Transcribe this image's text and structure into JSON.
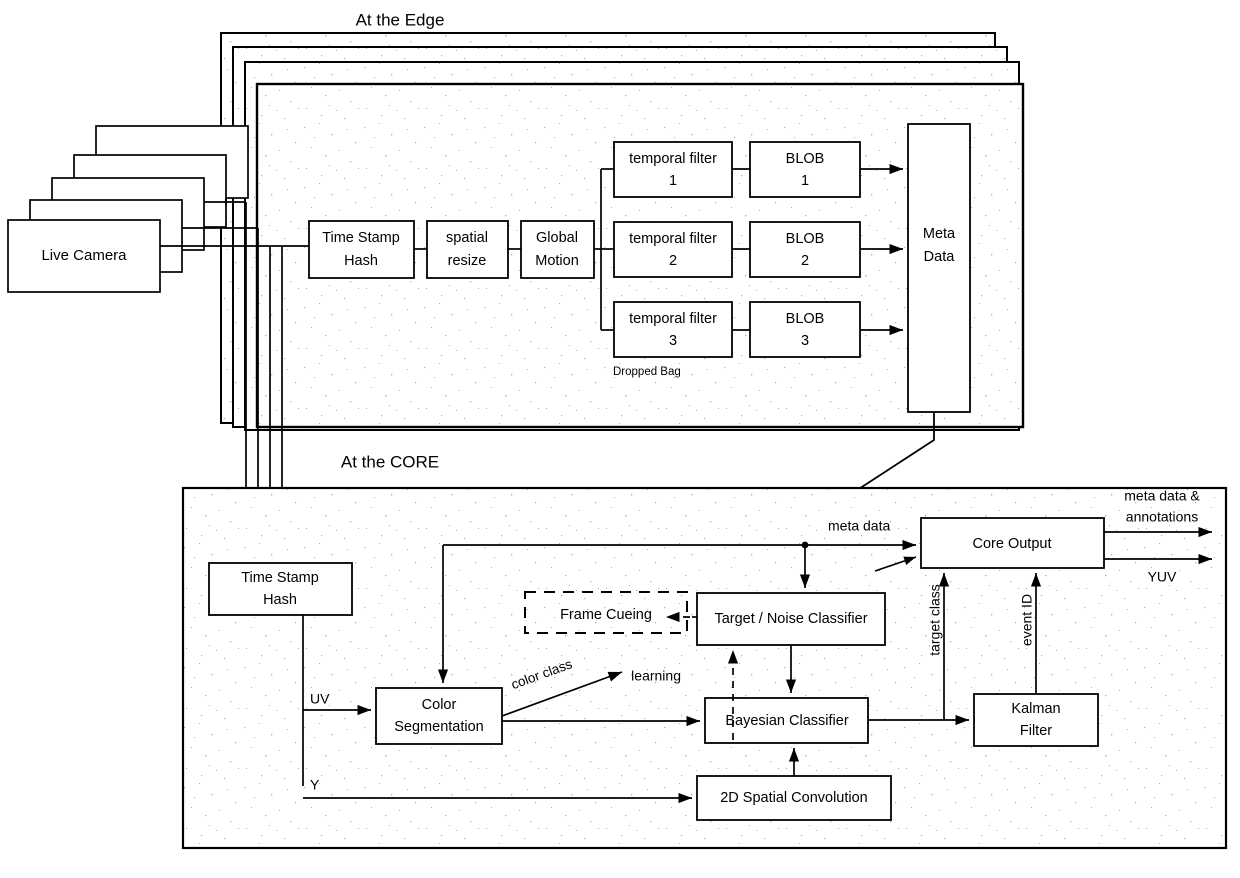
{
  "diagram": {
    "title_edge": "At the Edge",
    "title_core": "At the CORE",
    "edge": {
      "cameras": [
        {
          "label": "Live Camera"
        },
        {
          "label": "Live Camera"
        },
        {
          "label": "Live Camera"
        },
        {
          "label": "Live Camera"
        },
        {
          "label": "Live Camera"
        }
      ],
      "blocks": {
        "time_stamp_hash": "Time Stamp\nHash",
        "time_stamp_hash_l1": "Time Stamp",
        "time_stamp_hash_l2": "Hash",
        "spatial_resize_l1": "spatial",
        "spatial_resize_l2": "resize",
        "global_motion_l1": "Global",
        "global_motion_l2": "Motion",
        "temporal_filter_1_l1": "temporal filter",
        "temporal_filter_1_l2": "1",
        "temporal_filter_2_l1": "temporal filter",
        "temporal_filter_2_l2": "2",
        "temporal_filter_3_l1": "temporal filter",
        "temporal_filter_3_l2": "3",
        "blob_1_l1": "BLOB",
        "blob_1_l2": "1",
        "blob_2_l1": "BLOB",
        "blob_2_l2": "2",
        "blob_3_l1": "BLOB",
        "blob_3_l2": "3",
        "meta_data_l1": "Meta",
        "meta_data_l2": "Data"
      },
      "annotations": {
        "dropped_bag": "Dropped Bag"
      }
    },
    "core": {
      "blocks": {
        "time_stamp_hash_l1": "Time Stamp",
        "time_stamp_hash_l2": "Hash",
        "color_segmentation_l1": "Color",
        "color_segmentation_l2": "Segmentation",
        "frame_cueing": "Frame Cueing",
        "target_noise_classifier": "Target / Noise Classifier",
        "bayesian_classifier": "Bayesian Classifier",
        "spatial_convolution": "2D Spatial Convolution",
        "core_output": "Core Output",
        "kalman_filter_l1": "Kalman",
        "kalman_filter_l2": "Filter"
      },
      "annotations": {
        "uv": "UV",
        "y": "Y",
        "color_class": "color class",
        "learning": "learning",
        "meta_data": "meta data",
        "target_class": "target class",
        "event_id": "event ID",
        "meta_data_annotations_l1": "meta data &",
        "meta_data_annotations_l2": "annotations",
        "yuv": "YUV"
      }
    },
    "colors": {
      "stroke": "#000000",
      "fill": "#ffffff",
      "panel_fill": "#fbfbfb"
    }
  }
}
